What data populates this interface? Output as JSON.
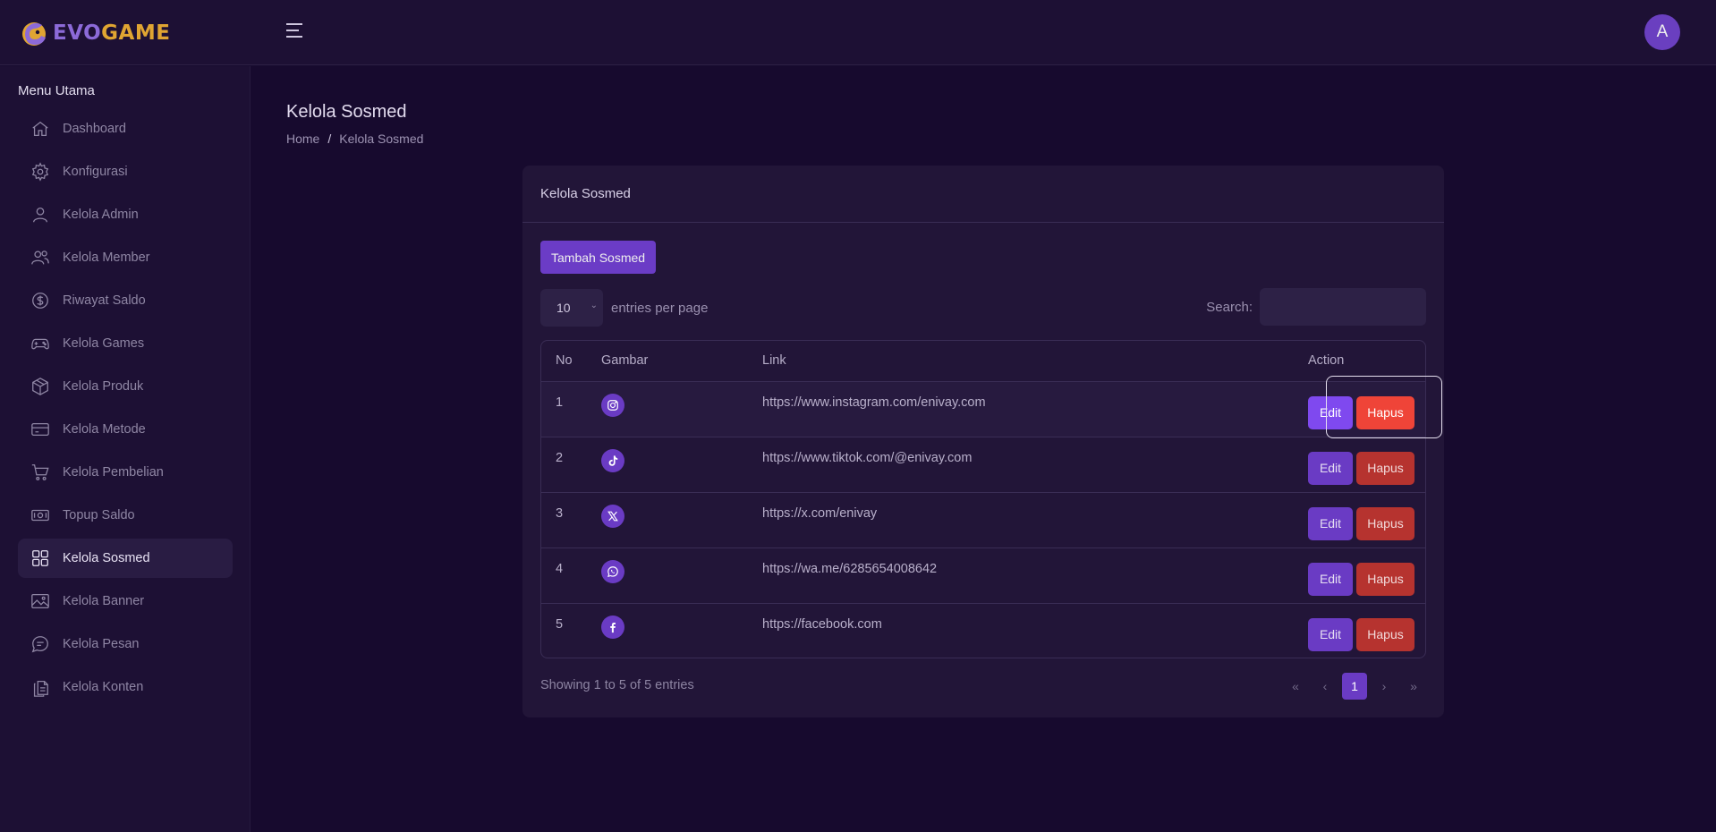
{
  "brand": {
    "part1": "EVO",
    "part2": "GAME",
    "color1": "#8c6ad8",
    "color2": "#e0a532"
  },
  "header": {
    "avatar_letter": "A"
  },
  "sidebar": {
    "title": "Menu Utama",
    "items": [
      {
        "label": "Dashboard",
        "icon": "home-icon"
      },
      {
        "label": "Konfigurasi",
        "icon": "gear-icon"
      },
      {
        "label": "Kelola Admin",
        "icon": "user-icon"
      },
      {
        "label": "Kelola Member",
        "icon": "users-icon"
      },
      {
        "label": "Riwayat Saldo",
        "icon": "dollar-circle-icon"
      },
      {
        "label": "Kelola Games",
        "icon": "gamepad-icon"
      },
      {
        "label": "Kelola Produk",
        "icon": "box-icon"
      },
      {
        "label": "Kelola Metode",
        "icon": "card-icon"
      },
      {
        "label": "Kelola Pembelian",
        "icon": "cart-icon"
      },
      {
        "label": "Topup Saldo",
        "icon": "cash-icon"
      },
      {
        "label": "Kelola Sosmed",
        "icon": "grid-icon",
        "active": true
      },
      {
        "label": "Kelola Banner",
        "icon": "image-icon"
      },
      {
        "label": "Kelola Pesan",
        "icon": "chat-icon"
      },
      {
        "label": "Kelola Konten",
        "icon": "document-icon"
      }
    ]
  },
  "page": {
    "title": "Kelola Sosmed",
    "breadcrumb": {
      "home": "Home",
      "sep": "/",
      "current": "Kelola Sosmed"
    }
  },
  "card": {
    "title": "Kelola Sosmed",
    "add_button": "Tambah Sosmed",
    "entries_value": "10",
    "entries_label": "entries per page",
    "search_label": "Search:",
    "search_value": "",
    "columns": {
      "no": "No",
      "image": "Gambar",
      "link": "Link",
      "action": "Action"
    },
    "rows": [
      {
        "no": "1",
        "icon": "instagram-icon",
        "link": "https://www.instagram.com/enivay.com",
        "edit": "Edit",
        "delete": "Hapus"
      },
      {
        "no": "2",
        "icon": "tiktok-icon",
        "link": "https://www.tiktok.com/@enivay.com",
        "edit": "Edit",
        "delete": "Hapus"
      },
      {
        "no": "3",
        "icon": "x-icon",
        "link": "https://x.com/enivay",
        "edit": "Edit",
        "delete": "Hapus"
      },
      {
        "no": "4",
        "icon": "whatsapp-icon",
        "link": "https://wa.me/6285654008642",
        "edit": "Edit",
        "delete": "Hapus"
      },
      {
        "no": "5",
        "icon": "facebook-icon",
        "link": "https://facebook.com",
        "edit": "Edit",
        "delete": "Hapus"
      }
    ],
    "showing": "Showing 1 to 5 of 5 entries",
    "pagination": {
      "first": "«",
      "prev": "‹",
      "current": "1",
      "next": "›",
      "last": "»"
    }
  },
  "colors": {
    "accent": "#6a3bc4",
    "danger": "#b6332f",
    "background": "#170a2e"
  }
}
